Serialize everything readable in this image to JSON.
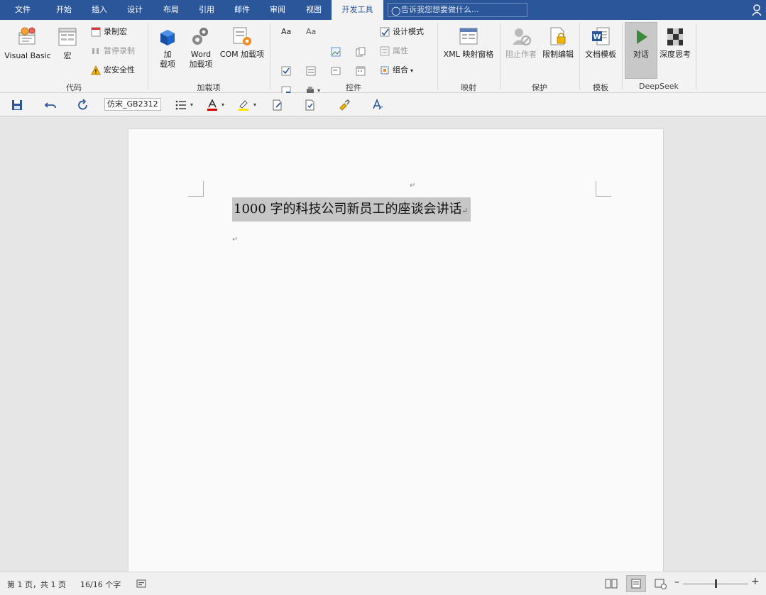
{
  "tabs": [
    {
      "label": "文件"
    },
    {
      "label": "开始"
    },
    {
      "label": "插入"
    },
    {
      "label": "设计"
    },
    {
      "label": "布局"
    },
    {
      "label": "引用"
    },
    {
      "label": "邮件"
    },
    {
      "label": "审阅"
    },
    {
      "label": "视图"
    },
    {
      "label": "开发工具"
    }
  ],
  "active_tab": "开发工具",
  "tell_me": {
    "placeholder": "告诉我您想要做什么..."
  },
  "ribbon": {
    "code": {
      "label": "代码",
      "visual_basic": "Visual Basic",
      "macros": "宏",
      "record_macro": "录制宏",
      "pause_recording": "暂停录制",
      "macro_security": "宏安全性"
    },
    "addins": {
      "label": "加载项",
      "addins_line1": "加",
      "addins_line2": "载项",
      "word_line1": "Word",
      "word_line2": "加载项",
      "com": "COM 加载项"
    },
    "controls": {
      "label": "控件",
      "design_mode": "设计模式",
      "properties": "属性",
      "group": "组合"
    },
    "mapping": {
      "label": "映射",
      "xml": "XML 映射窗格"
    },
    "protect": {
      "label": "保护",
      "block_authors": "阻止作者",
      "restrict_editing": "限制编辑"
    },
    "templates": {
      "label": "模板",
      "doc_template": "文档模板"
    },
    "deepseek": {
      "label": "DeepSeek",
      "dialog": "对话",
      "deep_think": "深度思考"
    }
  },
  "qat": {
    "font_name": "仿宋_GB2312"
  },
  "document": {
    "title": "1000 字的科技公司新员工的座谈会讲话"
  },
  "status": {
    "page": "第 1 页，共 1 页",
    "words": "16/16 个字"
  },
  "colors": {
    "accent": "#2b579a",
    "font_color": "#d00000",
    "highlight": "#ffe400",
    "deepseek_green": "#3a8a3a"
  }
}
